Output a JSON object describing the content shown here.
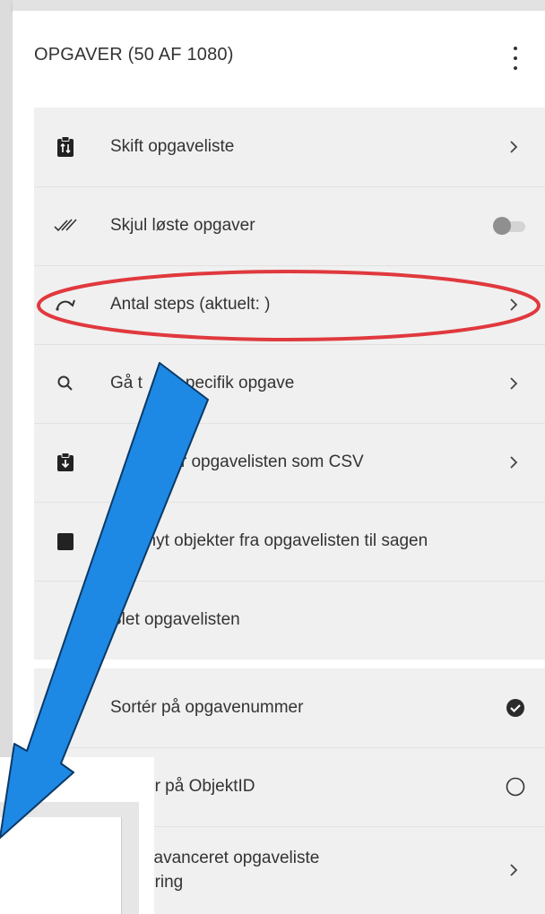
{
  "header": {
    "title": "OPGAVER (50 AF 1080)",
    "more_icon": "kebab-menu-icon"
  },
  "menu": {
    "items": [
      {
        "label": "Skift opgaveliste",
        "icon": "clipboard-swap-icon",
        "control": "chevron"
      },
      {
        "label": "Skjul løste opgaver",
        "icon": "double-check-icon",
        "control": "toggle",
        "toggle_on": false
      },
      {
        "label": "Antal steps (aktuelt: )",
        "icon": "step-arc-icon",
        "control": "chevron"
      },
      {
        "label": "Gå til specifik opgave",
        "visible_fragments": [
          "Gå t",
          "pecifik opgave"
        ],
        "icon": "search-icon",
        "control": "chevron"
      },
      {
        "label": "Eksportér opgavelisten som CSV",
        "visible_fragment": "ter opgavelisten som CSV",
        "icon": "clipboard-download-icon",
        "control": "chevron"
      },
      {
        "label": "Tilknyt objekter fra opgavelisten til sagen",
        "visible_fragment": "knyt objekter fra opgavelisten til sagen",
        "icon": "link-object-icon",
        "control": "none"
      },
      {
        "label": "Slet opgavelisten",
        "icon": "delete-icon",
        "control": "none"
      }
    ],
    "sort_items": [
      {
        "label": "Sortér på opgavenummer",
        "icon": "sort-icon",
        "control": "radio",
        "selected": true
      },
      {
        "label": "Sortér på ObjektID",
        "visible_fragment": "ér på ObjektID",
        "icon": "sort-icon",
        "control": "radio",
        "selected": false
      },
      {
        "label": "Til avanceret opgaveliste sortering",
        "visible_lines": [
          "l avanceret opgaveliste",
          "ering"
        ],
        "icon": "advanced-icon",
        "control": "chevron"
      }
    ]
  },
  "annotation": {
    "highlight_color": "#e0393e",
    "arrow_color": "#1e88e5",
    "arrow_outline": "#0a3a66"
  },
  "colors": {
    "panel_bg": "#ffffff",
    "menu_bg": "#f0f0f0",
    "divider": "#e2e2e2",
    "text": "#333333"
  }
}
